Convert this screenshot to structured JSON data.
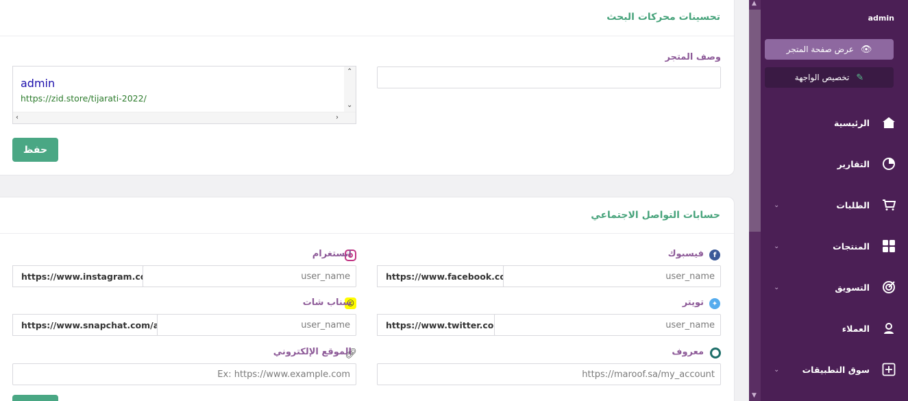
{
  "seo": {
    "title": "تحسينات محركات البحث",
    "store_description_label": "وصف المتجر",
    "store_description_value": "",
    "preview_title": "admin",
    "preview_url": "https://zid.store/tijarati-2022/",
    "save_label": "حفظ"
  },
  "social": {
    "title": "حسابات التواصل الاجتماعي",
    "facebook": {
      "label": "فيسبوك",
      "prefix": "https://www.facebook.com/",
      "placeholder": "user_name"
    },
    "instagram": {
      "label": "انستغرام",
      "prefix": "https://www.instagram.com/",
      "placeholder": "user_name"
    },
    "twitter": {
      "label": "تويتر",
      "prefix": "https://www.twitter.com/",
      "placeholder": "user_name"
    },
    "snapchat": {
      "label": "سناب شات",
      "prefix": "https://www.snapchat.com/add/",
      "placeholder": "user_name"
    },
    "maroof": {
      "label": "معروف",
      "placeholder": "https://maroof.sa/my_account"
    },
    "website": {
      "label": "الموقع الإلكتروني",
      "placeholder": "Ex: https://www.example.com"
    }
  },
  "sidebar": {
    "user": "admin",
    "view_store_label": "عرض صفحة المتجر",
    "customize_label": "تخصيص الواجهة",
    "items": [
      {
        "label": "الرئيسية",
        "icon": "home-icon"
      },
      {
        "label": "التقارير",
        "icon": "pie-chart-icon"
      },
      {
        "label": "الطلبات",
        "icon": "cart-icon"
      },
      {
        "label": "المنتجات",
        "icon": "grid-icon"
      },
      {
        "label": "التسويق",
        "icon": "target-icon"
      },
      {
        "label": "العملاء",
        "icon": "user-icon"
      },
      {
        "label": "سوق التطبيقات",
        "icon": "plus-box-icon"
      }
    ]
  },
  "colors": {
    "sidebar_bg": "#4b1f55",
    "accent_green": "#4aa784",
    "label_purple": "#8d5a98",
    "title_green": "#47a37b"
  }
}
